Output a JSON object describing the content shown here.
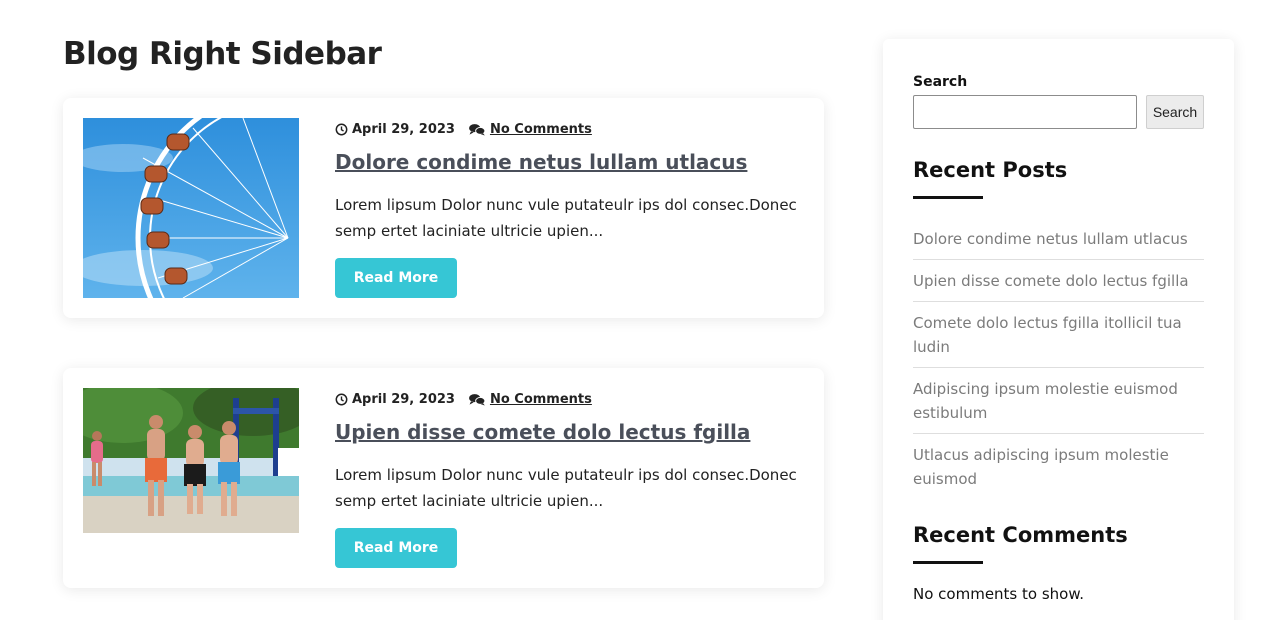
{
  "page": {
    "title": "Blog Right Sidebar"
  },
  "posts": [
    {
      "date": "April 29, 2023",
      "comments": "No Comments",
      "title": "Dolore condime netus lullam utlacus",
      "excerpt": "Lorem lipsum Dolor nunc vule putateulr ips dol consec.Donec semp ertet laciniate ultricie upien...",
      "read_more": "Read More",
      "image": "ferris-wheel"
    },
    {
      "date": "April 29, 2023",
      "comments": "No Comments",
      "title": "Upien disse comete dolo lectus fgilla",
      "excerpt": "Lorem lipsum Dolor nunc vule putateulr ips dol consec.Donec semp ertet laciniate ultricie upien...",
      "read_more": "Read More",
      "image": "kids-at-pool"
    }
  ],
  "sidebar": {
    "search": {
      "label": "Search",
      "button": "Search",
      "value": "",
      "placeholder": ""
    },
    "recent_posts": {
      "title": "Recent Posts",
      "items": [
        "Dolore condime netus lullam utlacus",
        "Upien disse comete dolo lectus fgilla",
        "Comete dolo lectus fgilla itollicil tua ludin",
        "Adipiscing ipsum molestie euismod estibulum",
        "Utlacus adipiscing ipsum molestie euismod"
      ]
    },
    "recent_comments": {
      "title": "Recent Comments",
      "empty_text": "No comments to show."
    }
  },
  "colors": {
    "accent": "#36c6d5",
    "title_link": "#4a4f5a",
    "sidebar_link": "#7b7b7b"
  },
  "icons": {
    "date": "clock-icon",
    "comments": "comments-icon"
  }
}
